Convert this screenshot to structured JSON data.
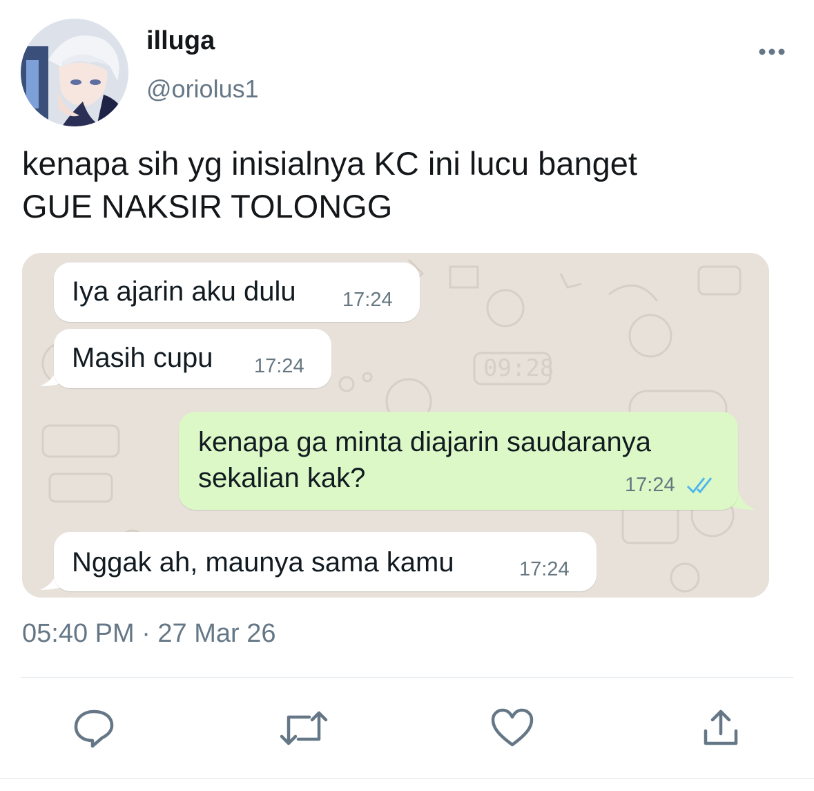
{
  "tweet": {
    "display_name": "illuga",
    "handle": "@oriolus1",
    "text": "kenapa sih yg inisialnya KC ini lucu banget\nGUE NAKSIR TOLONGG",
    "timestamp": "05:40 PM · 27 Mar 26",
    "icons": {
      "more": "more-horizontal-icon",
      "reply": "reply-icon",
      "retweet": "retweet-icon",
      "like": "heart-icon",
      "share": "share-icon"
    }
  },
  "chat": {
    "messages": [
      {
        "direction": "incoming",
        "text": "Iya ajarin aku dulu",
        "time": "17:24"
      },
      {
        "direction": "incoming",
        "text": "Masih cupu",
        "time": "17:24"
      },
      {
        "direction": "outgoing",
        "text": "kenapa ga minta diajarin saudaranya sekalian kak?",
        "time": "17:24",
        "status": "read"
      },
      {
        "direction": "incoming",
        "text": "Nggak ah, maunya sama kamu",
        "time": "17:24"
      }
    ],
    "wallpaper_doodle_text": "09:28",
    "colors": {
      "wallpaper": "#e7e1da",
      "incoming_bubble": "#ffffff",
      "outgoing_bubble": "#dcf8c6",
      "read_ticks": "#4fb6ec"
    }
  }
}
